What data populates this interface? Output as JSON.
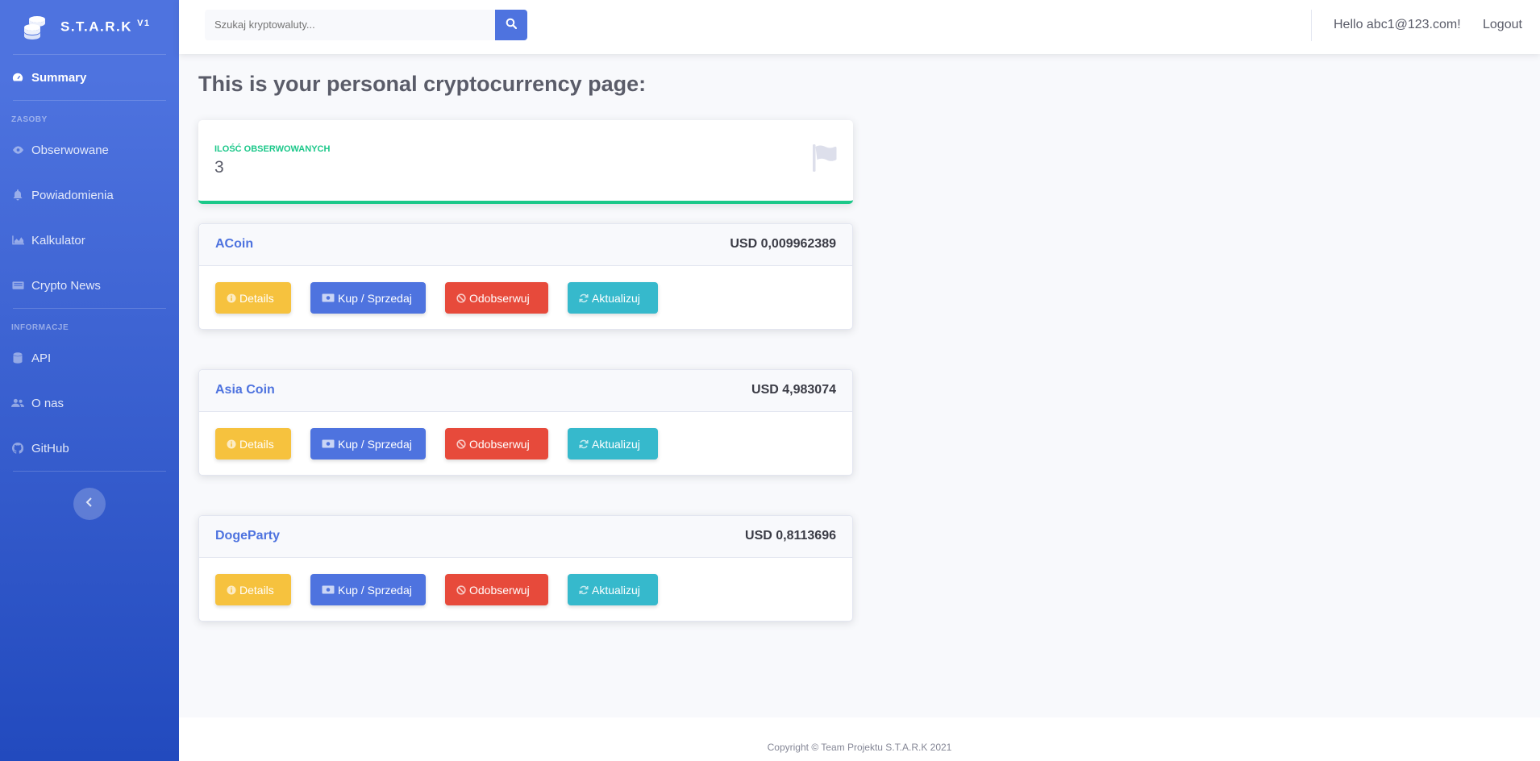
{
  "brand": {
    "name": "S.T.A.R.K",
    "version": "V1"
  },
  "sidebar": {
    "active": {
      "label": "Summary"
    },
    "heading1": "ZASOBY",
    "items1": [
      {
        "label": "Obserwowane",
        "icon": "eye-icon"
      },
      {
        "label": "Powiadomienia",
        "icon": "bell-icon"
      },
      {
        "label": "Kalkulator",
        "icon": "chart-area-icon"
      },
      {
        "label": "Crypto News",
        "icon": "newspaper-icon"
      }
    ],
    "heading2": "INFORMACJE",
    "items2": [
      {
        "label": "API",
        "icon": "database-icon"
      },
      {
        "label": "O nas",
        "icon": "users-icon"
      },
      {
        "label": "GitHub",
        "icon": "github-icon"
      }
    ]
  },
  "topbar": {
    "search_placeholder": "Szukaj kryptowaluty...",
    "greeting": "Hello abc1@123.com!",
    "logout": "Logout"
  },
  "main": {
    "title": "This is your personal cryptocurrency page:",
    "stat": {
      "label": "ILOŚĆ OBSERWOWANYCH",
      "value": "3"
    },
    "buttons": {
      "details": "Details",
      "trade": "Kup / Sprzedaj",
      "unfollow": "Odobserwuj",
      "update": "Aktualizuj"
    },
    "coins": [
      {
        "name": "ACoin",
        "price": "USD 0,009962389"
      },
      {
        "name": "Asia Coin",
        "price": "USD 4,983074"
      },
      {
        "name": "DogeParty",
        "price": "USD 0,8113696"
      }
    ]
  },
  "footer": {
    "copyright": "Copyright © Team Projektu S.T.A.R.K 2021"
  },
  "colors": {
    "primary": "#4e73df",
    "success": "#1cc88a",
    "warning": "#f6c23e",
    "danger": "#e74a3b",
    "info": "#36b9cc"
  }
}
